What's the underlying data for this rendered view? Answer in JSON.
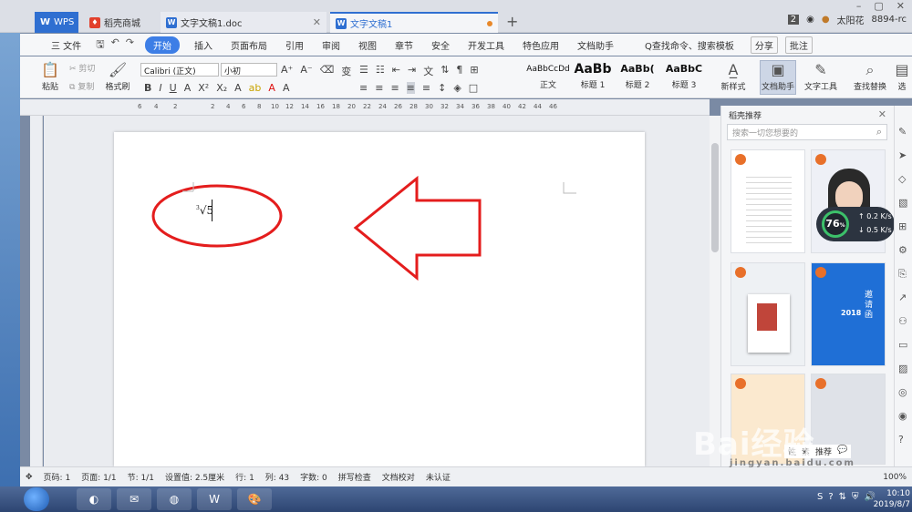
{
  "titlebar": {
    "tabs": [
      {
        "label": "WPS"
      },
      {
        "label": "稻壳商城"
      },
      {
        "label": "文字文稿1.doc"
      },
      {
        "label": "文字文稿1"
      }
    ],
    "badge_count": "2",
    "user": "太阳花",
    "user_id": "8894-rc"
  },
  "menubar": {
    "file": "三 文件",
    "items": [
      "开始",
      "插入",
      "页面布局",
      "引用",
      "审阅",
      "视图",
      "章节",
      "安全",
      "开发工具",
      "特色应用",
      "文档助手"
    ],
    "search": "Q查找命令、搜索模板",
    "share": "分享",
    "comment": "批注"
  },
  "ribbon": {
    "paste": "粘贴",
    "cut": "剪切",
    "copy": "复制",
    "format_painter": "格式刷",
    "font": "Calibri (正文)",
    "size": "小初",
    "styles": [
      {
        "sample": "AaBbCcDd",
        "label": "正文"
      },
      {
        "sample": "AaBb",
        "label": "标题 1"
      },
      {
        "sample": "AaBb(",
        "label": "标题 2"
      },
      {
        "sample": "AaBbC",
        "label": "标题 3"
      }
    ],
    "new_style": "新样式",
    "doc_assistant": "文档助手",
    "text_tools": "文字工具",
    "find_replace": "查找替换",
    "select": "选"
  },
  "ruler": {
    "ticks": [
      "6",
      "4",
      "2",
      "2",
      "4",
      "6",
      "8",
      "10",
      "12",
      "14",
      "16",
      "18",
      "20",
      "22",
      "24",
      "26",
      "28",
      "30",
      "32",
      "34",
      "36",
      "38",
      "40",
      "42",
      "44",
      "46"
    ]
  },
  "document": {
    "formula_index": "3",
    "formula_radicand": "√5"
  },
  "sidepanel": {
    "title": "稻壳推荐",
    "search_placeholder": "搜索一切您想要的",
    "card_text_1": "邀请函",
    "card_text_2": "2018",
    "bottom": [
      "性",
      "素",
      "推荐"
    ]
  },
  "speed": {
    "percent": "76",
    "up": "0.2",
    "down": "0.5",
    "unit": "K/s"
  },
  "statusbar": {
    "page": "页码: 1",
    "pages": "页面: 1/1",
    "section": "节: 1/1",
    "setting": "设置值: 2.5厘米",
    "row": "行: 1",
    "col": "列: 43",
    "words": "字数: 0",
    "spell": "拼写检查",
    "proof": "文档校对",
    "auth": "未认证",
    "zoom": "100%"
  },
  "taskbar": {
    "time": "10:10",
    "date": "2019/8/7"
  },
  "watermark": {
    "brand": "Bai经验",
    "url": "jingyan.baidu.com"
  }
}
